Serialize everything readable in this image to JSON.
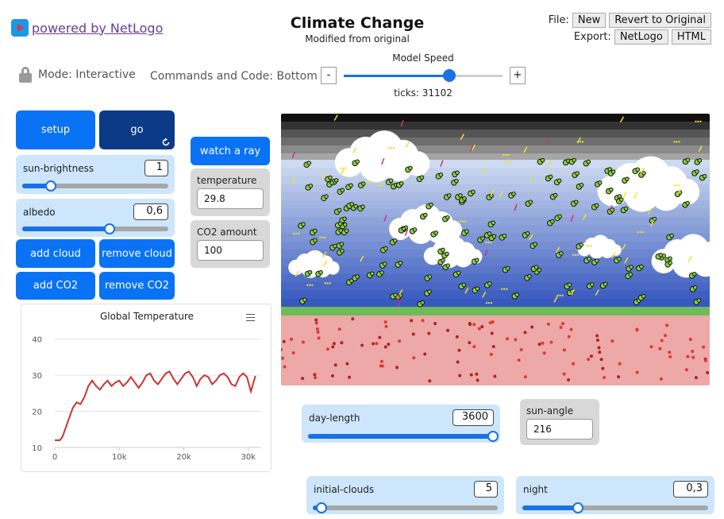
{
  "header": {
    "logo_link": "powered by NetLogo",
    "title": "Climate Change",
    "subtitle": "Modified from original",
    "file_label": "File:",
    "export_label": "Export:",
    "new_button": "New",
    "revert_button": "Revert to Original",
    "export_netlogo_button": "NetLogo",
    "export_html_button": "HTML"
  },
  "controls": {
    "mode": "Mode: Interactive",
    "commands_position": "Commands and Code: Bottom",
    "speed_label": "Model Speed",
    "speed_minus": "-",
    "speed_plus": "+",
    "speed_level": 0.67,
    "ticks": "ticks: 31102"
  },
  "buttons": {
    "setup": "setup",
    "go": "go",
    "watch_ray": "watch a ray",
    "add_cloud": "add cloud",
    "remove_cloud": "remove cloud",
    "add_co2": "add CO2",
    "remove_co2": "remove CO2"
  },
  "sliders": {
    "sun_brightness": {
      "name": "sun-brightness",
      "value": "1",
      "level": 0.2
    },
    "albedo": {
      "name": "albedo",
      "value": "0,6",
      "level": 0.6
    },
    "day_length": {
      "name": "day-length",
      "value": "3600",
      "level": 1.0
    },
    "initial_clouds": {
      "name": "initial-clouds",
      "value": "5",
      "level": 0.02
    },
    "night": {
      "name": "night",
      "value": "0,3",
      "level": 0.3
    }
  },
  "monitors": {
    "temperature": {
      "name": "temperature",
      "value": "29.8"
    },
    "co2": {
      "name": "CO2 amount",
      "value": "100"
    },
    "sun_angle": {
      "name": "sun-angle",
      "value": "216"
    }
  },
  "plot": {
    "title": "Global Temperature",
    "y_ticks": [
      "40",
      "30",
      "20",
      "10"
    ],
    "x_ticks": [
      "0",
      "10k",
      "20k",
      "30k"
    ]
  },
  "chart_data": {
    "type": "line",
    "title": "Global Temperature",
    "xlim": [
      0,
      32000
    ],
    "ylim": [
      10,
      43
    ],
    "grid": true,
    "series": [
      {
        "color": "#cc3333",
        "x": [
          0,
          800,
          1200,
          1600,
          2200,
          2800,
          3400,
          4000,
          4600,
          5200,
          5800,
          6400,
          7000,
          7600,
          8200,
          8800,
          9400,
          10000,
          10600,
          11200,
          11800,
          12400,
          13000,
          13600,
          14200,
          14800,
          15400,
          16000,
          16600,
          17200,
          17800,
          18400,
          19000,
          19600,
          20200,
          20800,
          21400,
          22000,
          22600,
          23200,
          23800,
          24400,
          25000,
          25600,
          26200,
          26800,
          27400,
          28000,
          28600,
          29200,
          29800,
          30400,
          31102
        ],
        "y": [
          12,
          12,
          13,
          15,
          18,
          21,
          22.5,
          22,
          24,
          27,
          28.5,
          27,
          26,
          27.5,
          28.5,
          27,
          28,
          28.5,
          27,
          28,
          29.5,
          28,
          26.5,
          28,
          30,
          30.5,
          28.5,
          27.5,
          29,
          30.5,
          31,
          29,
          27.5,
          29,
          30.5,
          31,
          29.5,
          27,
          29,
          30,
          29.5,
          27.5,
          28.5,
          30,
          30.5,
          29.5,
          27.5,
          27,
          29.5,
          30.5,
          29.5,
          25.5,
          29.8
        ]
      }
    ]
  },
  "colors": {
    "button_blue": "#0a72f5",
    "button_dark": "#0b3b86",
    "slider_bg": "#cde6fb",
    "monitor_bg": "#d8d8d8",
    "earth": "#eda9a7",
    "ground_strip": "#6fbb5a"
  }
}
